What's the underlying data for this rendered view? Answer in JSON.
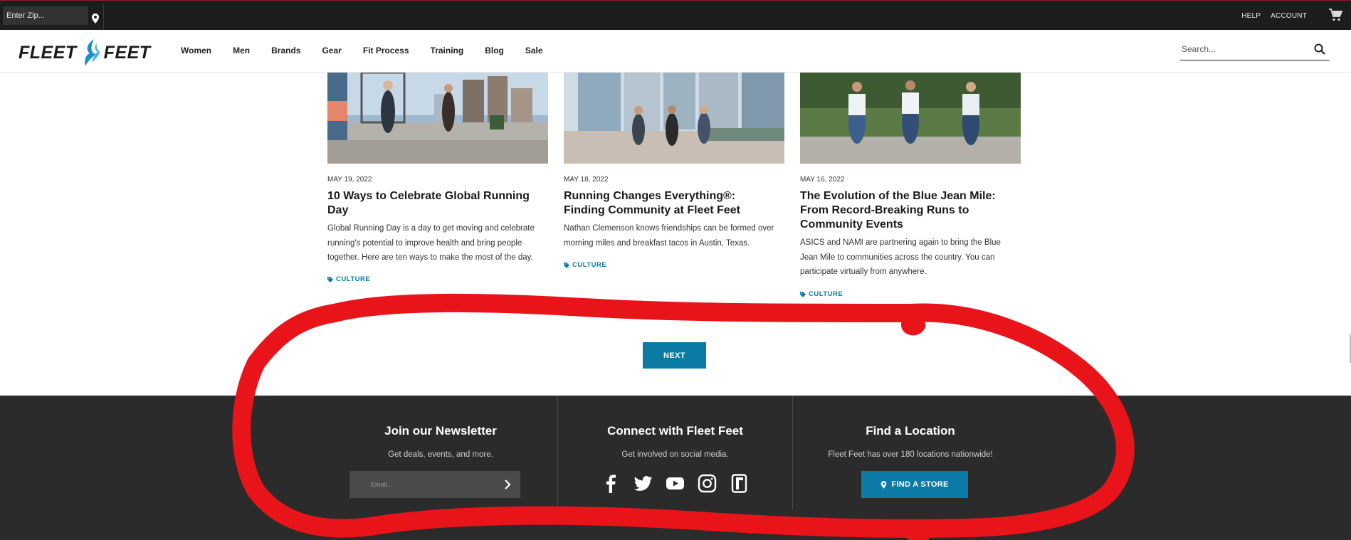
{
  "topbar": {
    "zip_placeholder": "Enter Zip...",
    "links": [
      "HELP",
      "ACCOUNT"
    ]
  },
  "nav": {
    "logo_left": "FLEET",
    "logo_right": "FEET",
    "items": [
      "Women",
      "Men",
      "Brands",
      "Gear",
      "Fit Process",
      "Training",
      "Blog",
      "Sale"
    ],
    "search_placeholder": "Search..."
  },
  "articles": [
    {
      "date": "MAY 19, 2022",
      "title": "10 Ways to Celebrate Global Running Day",
      "desc": "Global Running Day is a day to get moving and celebrate running's potential to improve health and bring people together. Here are ten ways to make the most of the day.",
      "tag": "CULTURE"
    },
    {
      "date": "MAY 18, 2022",
      "title": "Running Changes Everything®: Finding Community at Fleet Feet",
      "desc": "Nathan Clemenson knows friendships can be formed over morning miles and breakfast tacos in Austin, Texas.",
      "tag": "CULTURE"
    },
    {
      "date": "MAY 16, 2022",
      "title": "The Evolution of the Blue Jean Mile: From Record-Breaking Runs to Community Events",
      "desc": "ASICS and NAMI are partnering again to bring the Blue Jean Mile to communities across the country. You can participate virtually from anywhere.",
      "tag": "CULTURE"
    }
  ],
  "pagination": {
    "next_label": "NEXT"
  },
  "footer": {
    "newsletter": {
      "heading": "Join our Newsletter",
      "sub": "Get deals, events, and more.",
      "email_placeholder": "Email..."
    },
    "connect": {
      "heading": "Connect with Fleet Feet",
      "sub": "Get involved on social media.",
      "icons": [
        "facebook-icon",
        "twitter-icon",
        "youtube-icon",
        "instagram-icon",
        "strava-icon"
      ]
    },
    "location": {
      "heading": "Find a Location",
      "sub": "Fleet Feet has over 180 locations nationwide!",
      "button_label": "FIND A STORE"
    }
  },
  "colors": {
    "brand_blue": "#0b7ba6",
    "footer_bg": "#2b2b2b",
    "topbar_bg": "#1d1d1d",
    "annotation_red": "#e8141a"
  }
}
